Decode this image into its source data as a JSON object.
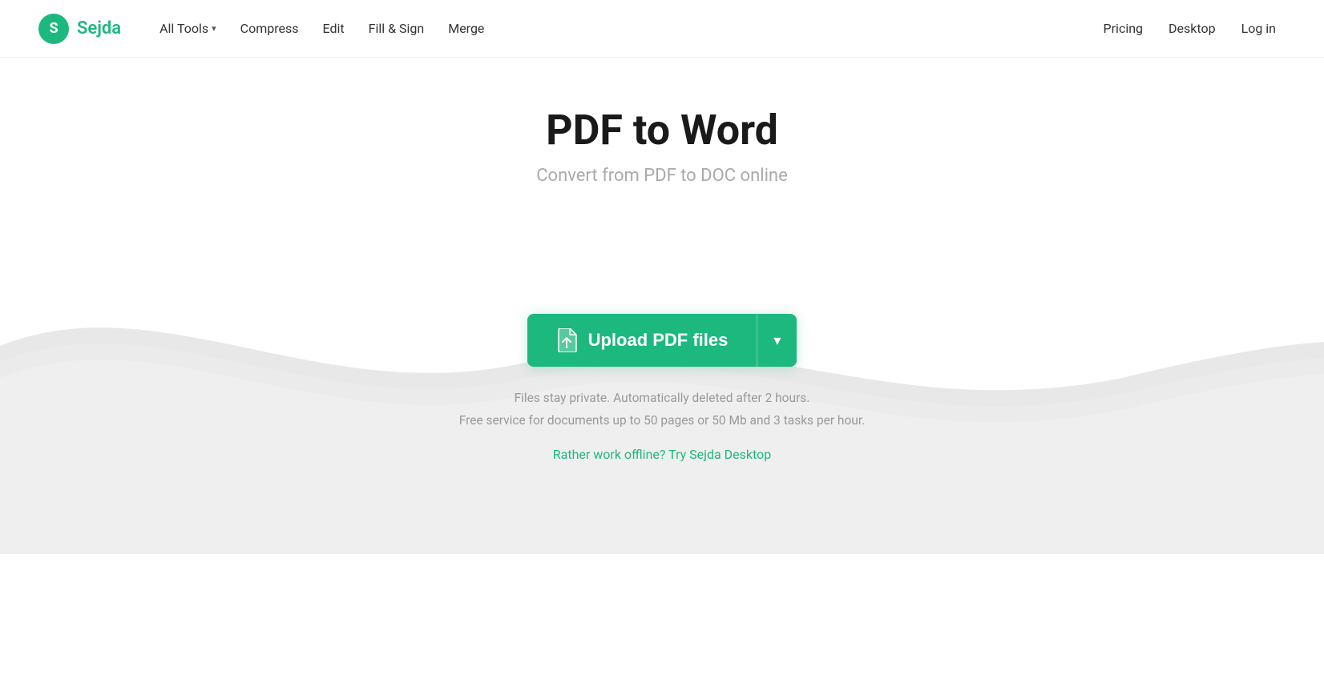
{
  "logo": {
    "letter": "S",
    "name": "Sejda"
  },
  "nav": {
    "all_tools_label": "All Tools",
    "compress_label": "Compress",
    "edit_label": "Edit",
    "fill_sign_label": "Fill & Sign",
    "merge_label": "Merge",
    "pricing_label": "Pricing",
    "desktop_label": "Desktop",
    "login_label": "Log in"
  },
  "hero": {
    "title": "PDF to Word",
    "subtitle": "Convert from PDF to DOC online"
  },
  "upload": {
    "button_label": "Upload PDF files",
    "icon": "📄"
  },
  "info": {
    "line1": "Files stay private. Automatically deleted after 2 hours.",
    "line2": "Free service for documents up to 50 pages or 50 Mb and 3 tasks per hour.",
    "offline_link": "Rather work offline? Try Sejda Desktop"
  }
}
